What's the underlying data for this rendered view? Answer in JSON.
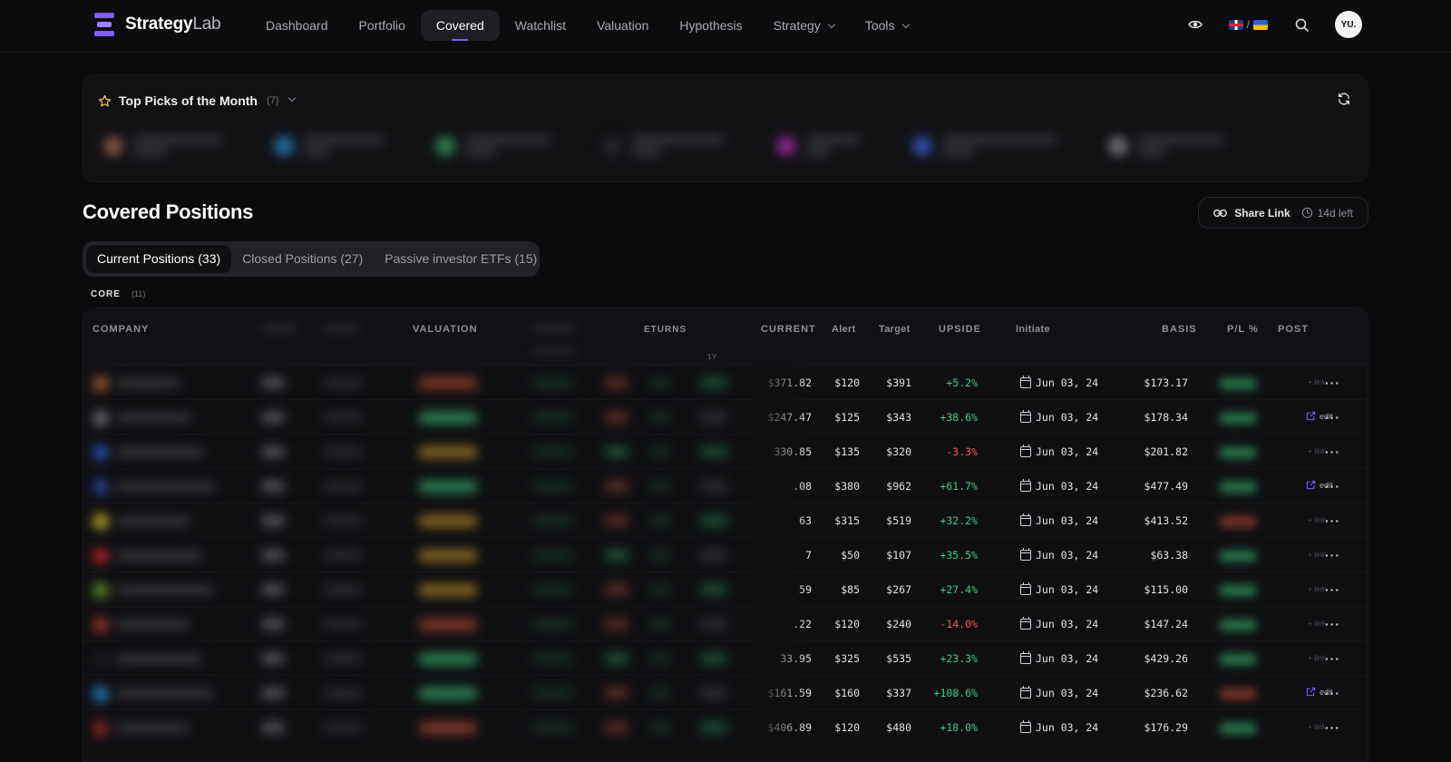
{
  "brand": {
    "name_bold": "Strategy",
    "name_light": "Lab"
  },
  "nav": {
    "items": [
      {
        "label": "Dashboard"
      },
      {
        "label": "Portfolio"
      },
      {
        "label": "Covered",
        "active": true
      },
      {
        "label": "Watchlist"
      },
      {
        "label": "Valuation"
      },
      {
        "label": "Hypothesis"
      },
      {
        "label": "Strategy",
        "dropdown": true
      },
      {
        "label": "Tools",
        "dropdown": true
      }
    ],
    "lang_sep": "/",
    "avatar": "YU."
  },
  "picks": {
    "title": "Top Picks of the Month",
    "count": "(7)"
  },
  "section": {
    "title": "Covered Positions",
    "share_label": "Share Link",
    "time_left": "14d left"
  },
  "tabs": [
    {
      "label": "Current Positions (33)",
      "active": true
    },
    {
      "label": "Closed Positions (27)"
    },
    {
      "label": "Passive investor ETFs (15)"
    }
  ],
  "group": {
    "label": "CORE",
    "count": "(11)"
  },
  "table": {
    "headers": {
      "company": "COMPANY",
      "valuation": "VALUATION",
      "returns": "ETURNS",
      "returns_sub": "1Y",
      "current": "CURRENT",
      "alert": "Alert",
      "target": "Target",
      "upside": "UPSIDE",
      "initiate": "Initiate",
      "basis": "BASIS",
      "pl": "P/L %",
      "post": "POST"
    },
    "rows": [
      {
        "current": "$371.82",
        "alert": "$120",
        "target": "$391",
        "upside": "+5.2%",
        "sign": "pos",
        "initiate": "Jun 03, 24",
        "basis": "$173.17",
        "post": "+ link",
        "post_type": "link"
      },
      {
        "current": "$247.47",
        "alert": "$125",
        "target": "$343",
        "upside": "+38.6%",
        "sign": "pos",
        "initiate": "Jun 03, 24",
        "basis": "$178.34",
        "post": "edit",
        "post_type": "edit"
      },
      {
        "current": "330.85",
        "alert": "$135",
        "target": "$320",
        "upside": "-3.3%",
        "sign": "neg",
        "initiate": "Jun 03, 24",
        "basis": "$201.82",
        "post": "+ link",
        "post_type": "link"
      },
      {
        "current": ".08",
        "alert": "$380",
        "target": "$962",
        "upside": "+61.7%",
        "sign": "pos",
        "initiate": "Jun 03, 24",
        "basis": "$477.49",
        "post": "edit",
        "post_type": "edit"
      },
      {
        "current": "63",
        "alert": "$315",
        "target": "$519",
        "upside": "+32.2%",
        "sign": "pos",
        "initiate": "Jun 03, 24",
        "basis": "$413.52",
        "post": "+ link",
        "post_type": "link"
      },
      {
        "current": "7",
        "alert": "$50",
        "target": "$107",
        "upside": "+35.5%",
        "sign": "pos",
        "initiate": "Jun 03, 24",
        "basis": "$63.38",
        "post": "+ link",
        "post_type": "link"
      },
      {
        "current": "59",
        "alert": "$85",
        "target": "$267",
        "upside": "+27.4%",
        "sign": "pos",
        "initiate": "Jun 03, 24",
        "basis": "$115.00",
        "post": "+ link",
        "post_type": "link"
      },
      {
        "current": ".22",
        "alert": "$120",
        "target": "$240",
        "upside": "-14.0%",
        "sign": "neg",
        "initiate": "Jun 03, 24",
        "basis": "$147.24",
        "post": "+ link",
        "post_type": "link"
      },
      {
        "current": "33.95",
        "alert": "$325",
        "target": "$535",
        "upside": "+23.3%",
        "sign": "pos",
        "initiate": "Jun 03, 24",
        "basis": "$429.26",
        "post": "+ link",
        "post_type": "link"
      },
      {
        "current": "$161.59",
        "alert": "$160",
        "target": "$337",
        "upside": "+108.6%",
        "sign": "pos",
        "initiate": "Jun 03, 24",
        "basis": "$236.62",
        "post": "edit",
        "post_type": "edit"
      },
      {
        "current": "$406.89",
        "alert": "$120",
        "target": "$480",
        "upside": "+18.0%",
        "sign": "pos",
        "initiate": "Jun 03, 24",
        "basis": "$176.29",
        "post": "+ link",
        "post_type": "link"
      }
    ]
  },
  "colors": {
    "accent": "#7c5cff",
    "positive": "#3ccf82",
    "negative": "#f15b5b",
    "background": "#0b0b0d"
  },
  "icons": {
    "visibility": "eye-icon",
    "search": "search-icon",
    "star": "star-icon",
    "refresh": "refresh-icon",
    "share": "link-icon",
    "clock": "clock-icon",
    "calendar": "calendar-icon",
    "edit": "external-edit-icon",
    "more": "more-horizontal-icon"
  }
}
